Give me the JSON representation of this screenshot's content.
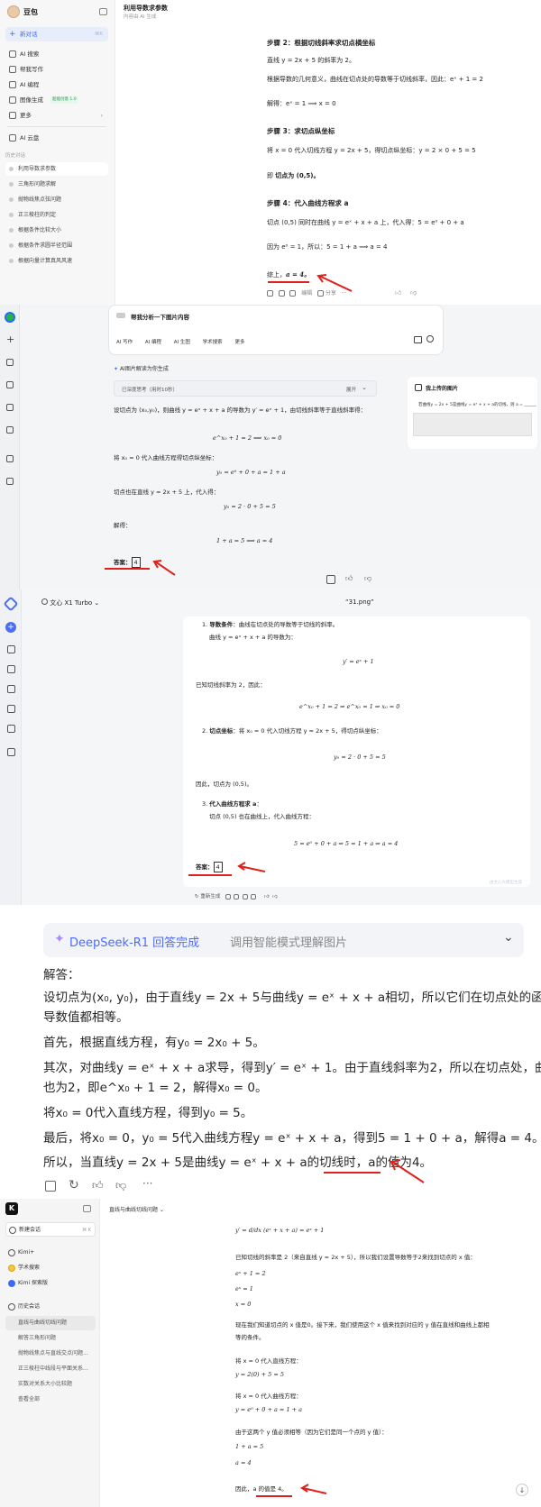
{
  "doubao": {
    "brand": "豆包",
    "nav": [
      "新对话",
      "AI 搜索",
      "帮我写作",
      "AI 编程",
      "图像生成",
      "更多",
      "AI 云盘"
    ],
    "new_shortcut": "⌘K",
    "image_badge": "超能创意 1.0",
    "history_label": "历史对话",
    "history": [
      "利用导数求参数",
      "三角形问题求解",
      "抛物线焦点弦问题",
      "正三棱柱的判定",
      "根据条件比较大小",
      "根据条件求圆半径范围",
      "根据向量计算真风风速"
    ],
    "title": "利用导数求参数",
    "subtitle": "内容由 AI 生成",
    "step2": "步骤 2：根据切线斜率求切点横坐标",
    "s2_l1": "直线 y = 2x + 5 的斜率为 2。",
    "s2_l2": "根据导数的几何意义，曲线在切点处的导数等于切线斜率，因此：eˣ + 1 = 2",
    "s2_l3": "解得：eˣ = 1 ⟹ x = 0",
    "step3": "步骤 3：求切点纵坐标",
    "s3_l1": "将 x = 0 代入切线方程 y = 2x + 5，得切点纵坐标：y = 2 × 0 + 5 = 5",
    "s3_l2a": "即",
    "s3_l2b": "切点为 (0,5)。",
    "step4": "步骤 4：代入曲线方程求 a",
    "s4_l1": "切点 (0,5) 同时在曲线 y = eˣ + x + a 上，代入得：5 = e⁰ + 0 + a",
    "s4_l2": "因为 e⁰ = 1，所以：5 = 1 + a ⟹ a = 4",
    "s4_l3a": "综上，",
    "s4_l3b": "a = 4。",
    "action_edit": "编辑",
    "action_share": "分享",
    "input_placeholder": "帮我分析一下图片内容",
    "chips": [
      "AI 写作",
      "AI 编程",
      "AI 生图",
      "学术搜索",
      "更多"
    ]
  },
  "yuanbao": {
    "banner": "AI图片解读为你生成",
    "think": "已深度思考（用时10秒）",
    "expand": "展开",
    "upload_title": "我上传的图片",
    "upload_text": "若曲线y = 2x + 5是曲线y = eˣ + x + a的切线，则 a = ______",
    "l1": "设切点为 (x₀,y₀)，则曲线 y = eˣ + x + a 的导数为 y′ = eˣ + 1，由切线斜率等于直线斜率得：",
    "e1": "e^x₀ + 1 = 2  ⟹  x₀ = 0",
    "l2": "将 x₀ = 0 代入曲线方程得切点纵坐标：",
    "e2": "y₀ = e⁰ + 0 + a = 1 + a",
    "l3": "切点也在直线 y = 2x + 5 上，代入得：",
    "e3": "y₀ = 2 · 0 + 5 = 5",
    "l4": "解得：",
    "e4": "1 + a = 5  ⟹  a = 4",
    "answer_label": "答案：",
    "answer_value": "4"
  },
  "wenxin": {
    "model": "文心 X1 Turbo",
    "file": "“31.png”",
    "i1": "1.",
    "h1a": "导数条件",
    "h1b": "：曲线在切点处的导数等于切线的斜率。",
    "t1": "曲线 y = eˣ + x + a 的导数为：",
    "e1": "y′ = eˣ + 1",
    "t2": "已知切线斜率为 2，因此：",
    "e2": "e^x₀ + 1 = 2   ⇒   e^x₀ = 1   ⇒   x₀ = 0",
    "i2": "2.",
    "h2a": "切点坐标",
    "h2b": "：将 x₀ = 0 代入切线方程 y = 2x + 5，得切点纵坐标：",
    "e3": "y₀ = 2 · 0 + 5 = 5",
    "t3": "因此，切点为 (0,5)。",
    "i3": "3.",
    "h3a": "代入曲线方程求 a",
    "h3b": "：",
    "t4": "切点 (0,5) 也在曲线上，代入曲线方程：",
    "e4": "5 = e⁰ + 0 + a   ⇒   5 = 1 + a   ⇒   a = 4",
    "answer_label": "答案：",
    "answer_value": "4",
    "regen": "重新生成",
    "watermark": "由文心大模型生成"
  },
  "deepseek": {
    "status_main": "DeepSeek-R1 回答完成",
    "status_sub": "调用智能模式理解图片",
    "p0": "解答：",
    "p1a": "设切点为(x₀, y₀)，由于直线y = 2x + 5与曲线y = eˣ + x + a相切，所以它们在切点处的函数值和",
    "p1b": "导数值都相等。",
    "p2": "首先，根据直线方程，有y₀ = 2x₀ + 5。",
    "p3a": "其次，对曲线y = eˣ + x + a求导，得到y′ = eˣ + 1。由于直线斜率为2，所以在切点处，曲线斜率",
    "p3b": "也为2，即e^x₀ + 1 = 2，解得x₀ = 0。",
    "p4": "将x₀ = 0代入直线方程，得到y₀ = 5。",
    "p5": "最后，将x₀ = 0，y₀ = 5代入曲线方程y = eˣ + x + a，得到5 = 1 + 0 + a，解得a = 4。",
    "p6a": "所以，当直线y = 2x + 5是曲线y = eˣ + x + a的切线时，",
    "p6b": "a的值为4。"
  },
  "kimi": {
    "logo": "K",
    "new_chat": "新建会话",
    "kbd": "⌘ K",
    "nav": [
      "Kimi+",
      "学术搜索",
      "Kimi 探索版"
    ],
    "hist_label": "历史会话",
    "history": [
      "直线与曲线切线问题",
      "解答三角形问题",
      "抛物线焦点与直线交点问题...",
      "正三棱柱中线段与平面关系...",
      "实数对关系大小比较题",
      "查看全部"
    ],
    "title": "直线与曲线切线问题",
    "l1": "y′ = d/dx (eˣ + x + a) = eˣ + 1",
    "l2": "已知切线的斜率是 2（来自直线 y = 2x + 5），所以我们设置导数等于2来找到切点的 x 值：",
    "l3": "eˣ + 1 = 2",
    "l4": "eˣ = 1",
    "l5": "x = 0",
    "l6a": "现在我们知道切点的 x 值是0。接下来，我们使用这个 x 值来找到对应的 y 值在直线和曲线上都相",
    "l6b": "等的条件。",
    "l7": "将 x = 0 代入直线方程：",
    "l8": "y = 2(0) + 5 = 5",
    "l9": "将 x = 0 代入曲线方程：",
    "l10": "y = e⁰ + 0 + a = 1 + a",
    "l11": "由于这两个 y 值必须相等（因为它们是同一个点的 y 值）：",
    "l12": "1 + a = 5",
    "l13": "a = 4",
    "l14a": "因此，",
    "l14b": "a 的值是 4。"
  },
  "colors": {
    "red": "#e0201b",
    "doubao_blue": "#3b6cf6",
    "deepseek_blue": "#4d6bfe",
    "wenxin_blue": "#4e6ef2"
  }
}
